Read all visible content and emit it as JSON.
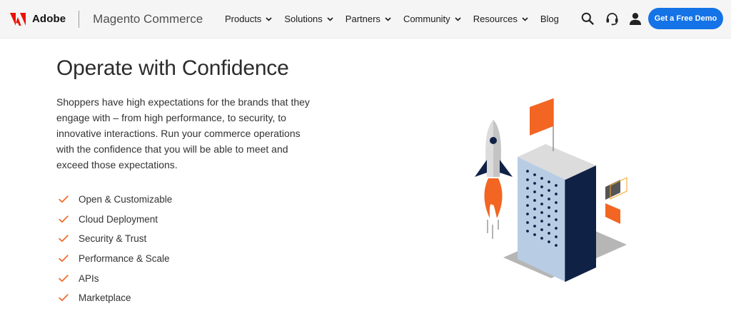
{
  "header": {
    "brand_name": "Adobe",
    "product_name": "Magento Commerce",
    "nav": [
      {
        "label": "Products",
        "has_menu": true
      },
      {
        "label": "Solutions",
        "has_menu": true
      },
      {
        "label": "Partners",
        "has_menu": true
      },
      {
        "label": "Community",
        "has_menu": true
      },
      {
        "label": "Resources",
        "has_menu": true
      },
      {
        "label": "Blog",
        "has_menu": false
      }
    ],
    "icons": [
      "search-icon",
      "headset-icon",
      "user-icon"
    ],
    "cta_label": "Get a Free Demo"
  },
  "main": {
    "headline": "Operate with Confidence",
    "intro": "Shoppers have high expectations for the brands that they engage with – from high performance, to security, to innovative interactions. Run your commerce operations with the confidence that you will be able to meet and exceed those expectations.",
    "features": [
      "Open & Customizable",
      "Cloud Deployment",
      "Security & Trust",
      "Performance & Scale",
      "APIs",
      "Marketplace"
    ]
  },
  "colors": {
    "brand_red": "#eb1000",
    "cta_blue": "#1473e6",
    "accent_orange": "#f26522",
    "navy": "#0f2145",
    "building_light": "#b8cce4"
  }
}
